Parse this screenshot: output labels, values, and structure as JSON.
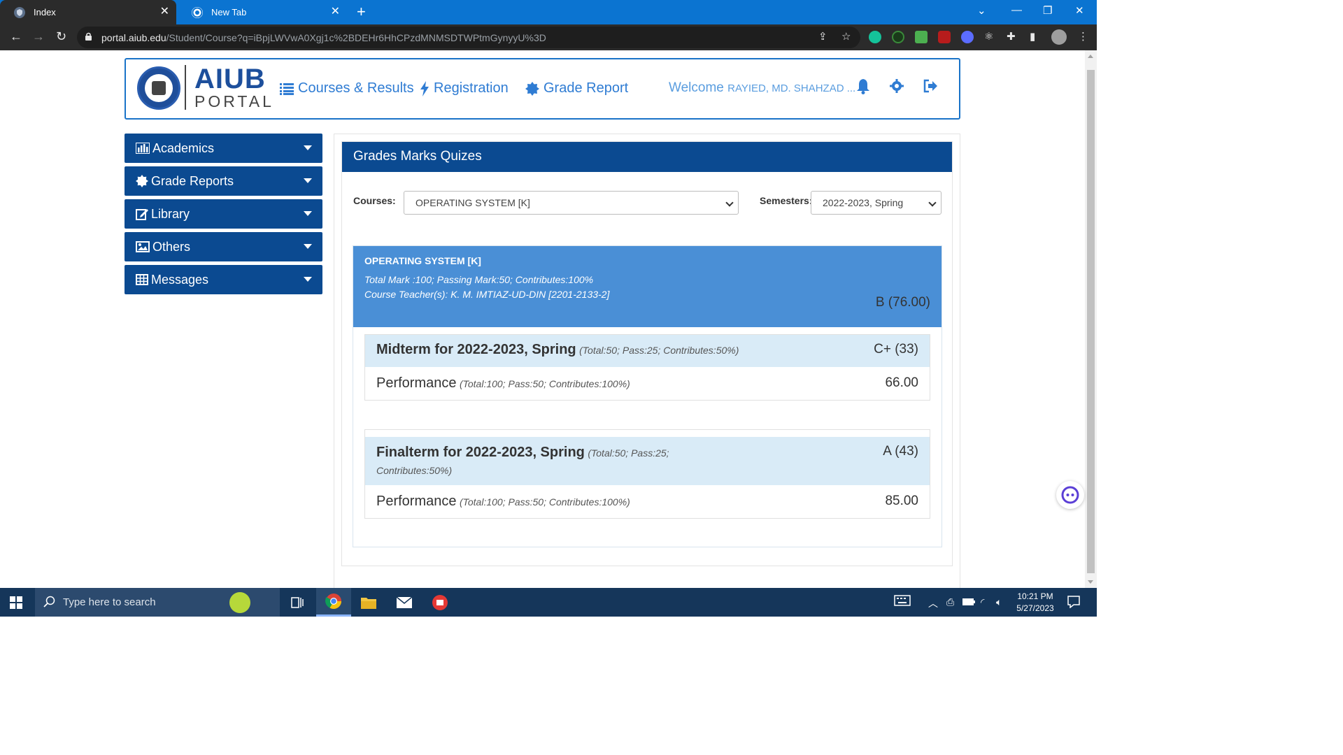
{
  "browser": {
    "tabs": [
      {
        "title": "Index",
        "active": true
      },
      {
        "title": "New Tab",
        "active": false
      }
    ],
    "url_host": "portal.aiub.edu",
    "url_path": "/Student/Course?q=iBpjLWVwA0Xgj1c%2BDEHr6HhCPzdMNMSDTWPtmGynyyU%3D"
  },
  "header": {
    "logo_title": "AIUB",
    "logo_subtitle": "PORTAL",
    "nav": [
      {
        "label": "Courses & Results",
        "icon": "list-icon"
      },
      {
        "label": "Registration",
        "icon": "bolt-icon"
      },
      {
        "label": "Grade Report",
        "icon": "certificate-icon"
      }
    ],
    "welcome_prefix": "Welcome",
    "welcome_name": "RAYIED, MD. SHAHZAD ..."
  },
  "sidebar": {
    "items": [
      {
        "label": "Academics",
        "icon": "bar-chart-icon"
      },
      {
        "label": "Grade Reports",
        "icon": "certificate-icon"
      },
      {
        "label": "Library",
        "icon": "edit-icon"
      },
      {
        "label": "Others",
        "icon": "picture-icon"
      },
      {
        "label": "Messages",
        "icon": "table-icon"
      }
    ]
  },
  "main": {
    "panel_title": "Grades Marks Quizes",
    "courses_label": "Courses:",
    "courses_value": "OPERATING SYSTEM [K]",
    "semesters_label": "Semesters:",
    "semesters_value": "2022-2023, Spring",
    "course": {
      "title": "OPERATING SYSTEM [K]",
      "marks_info": "Total Mark :100; Passing Mark:50; Contributes:100%",
      "teacher": "Course Teacher(s): K. M. IMTIAZ-UD-DIN [2201-2133-2]",
      "grade": "B (76.00)"
    },
    "terms": [
      {
        "title": "Midterm for 2022-2023, Spring",
        "meta": "(Total:50; Pass:25; Contributes:50%)",
        "grade": "C+ (33)",
        "row_title": "Performance",
        "row_meta": "(Total:100; Pass:50; Contributes:100%)",
        "row_value": "66.00"
      },
      {
        "title": "Finalterm for 2022-2023, Spring",
        "meta": "(Total:50; Pass:25; Contributes:50%)",
        "grade": "A (43)",
        "row_title": "Performance",
        "row_meta": "(Total:100; Pass:50; Contributes:100%)",
        "row_value": "85.00"
      }
    ]
  },
  "taskbar": {
    "search_placeholder": "Type here to search",
    "time": "10:21 PM",
    "date": "5/27/2023"
  },
  "colors": {
    "brand_dark_blue": "#0b4a91",
    "header_link_blue": "#2f7cd3",
    "course_header_blue": "#4a8fd6",
    "term_header_light": "#d9ebf7"
  }
}
